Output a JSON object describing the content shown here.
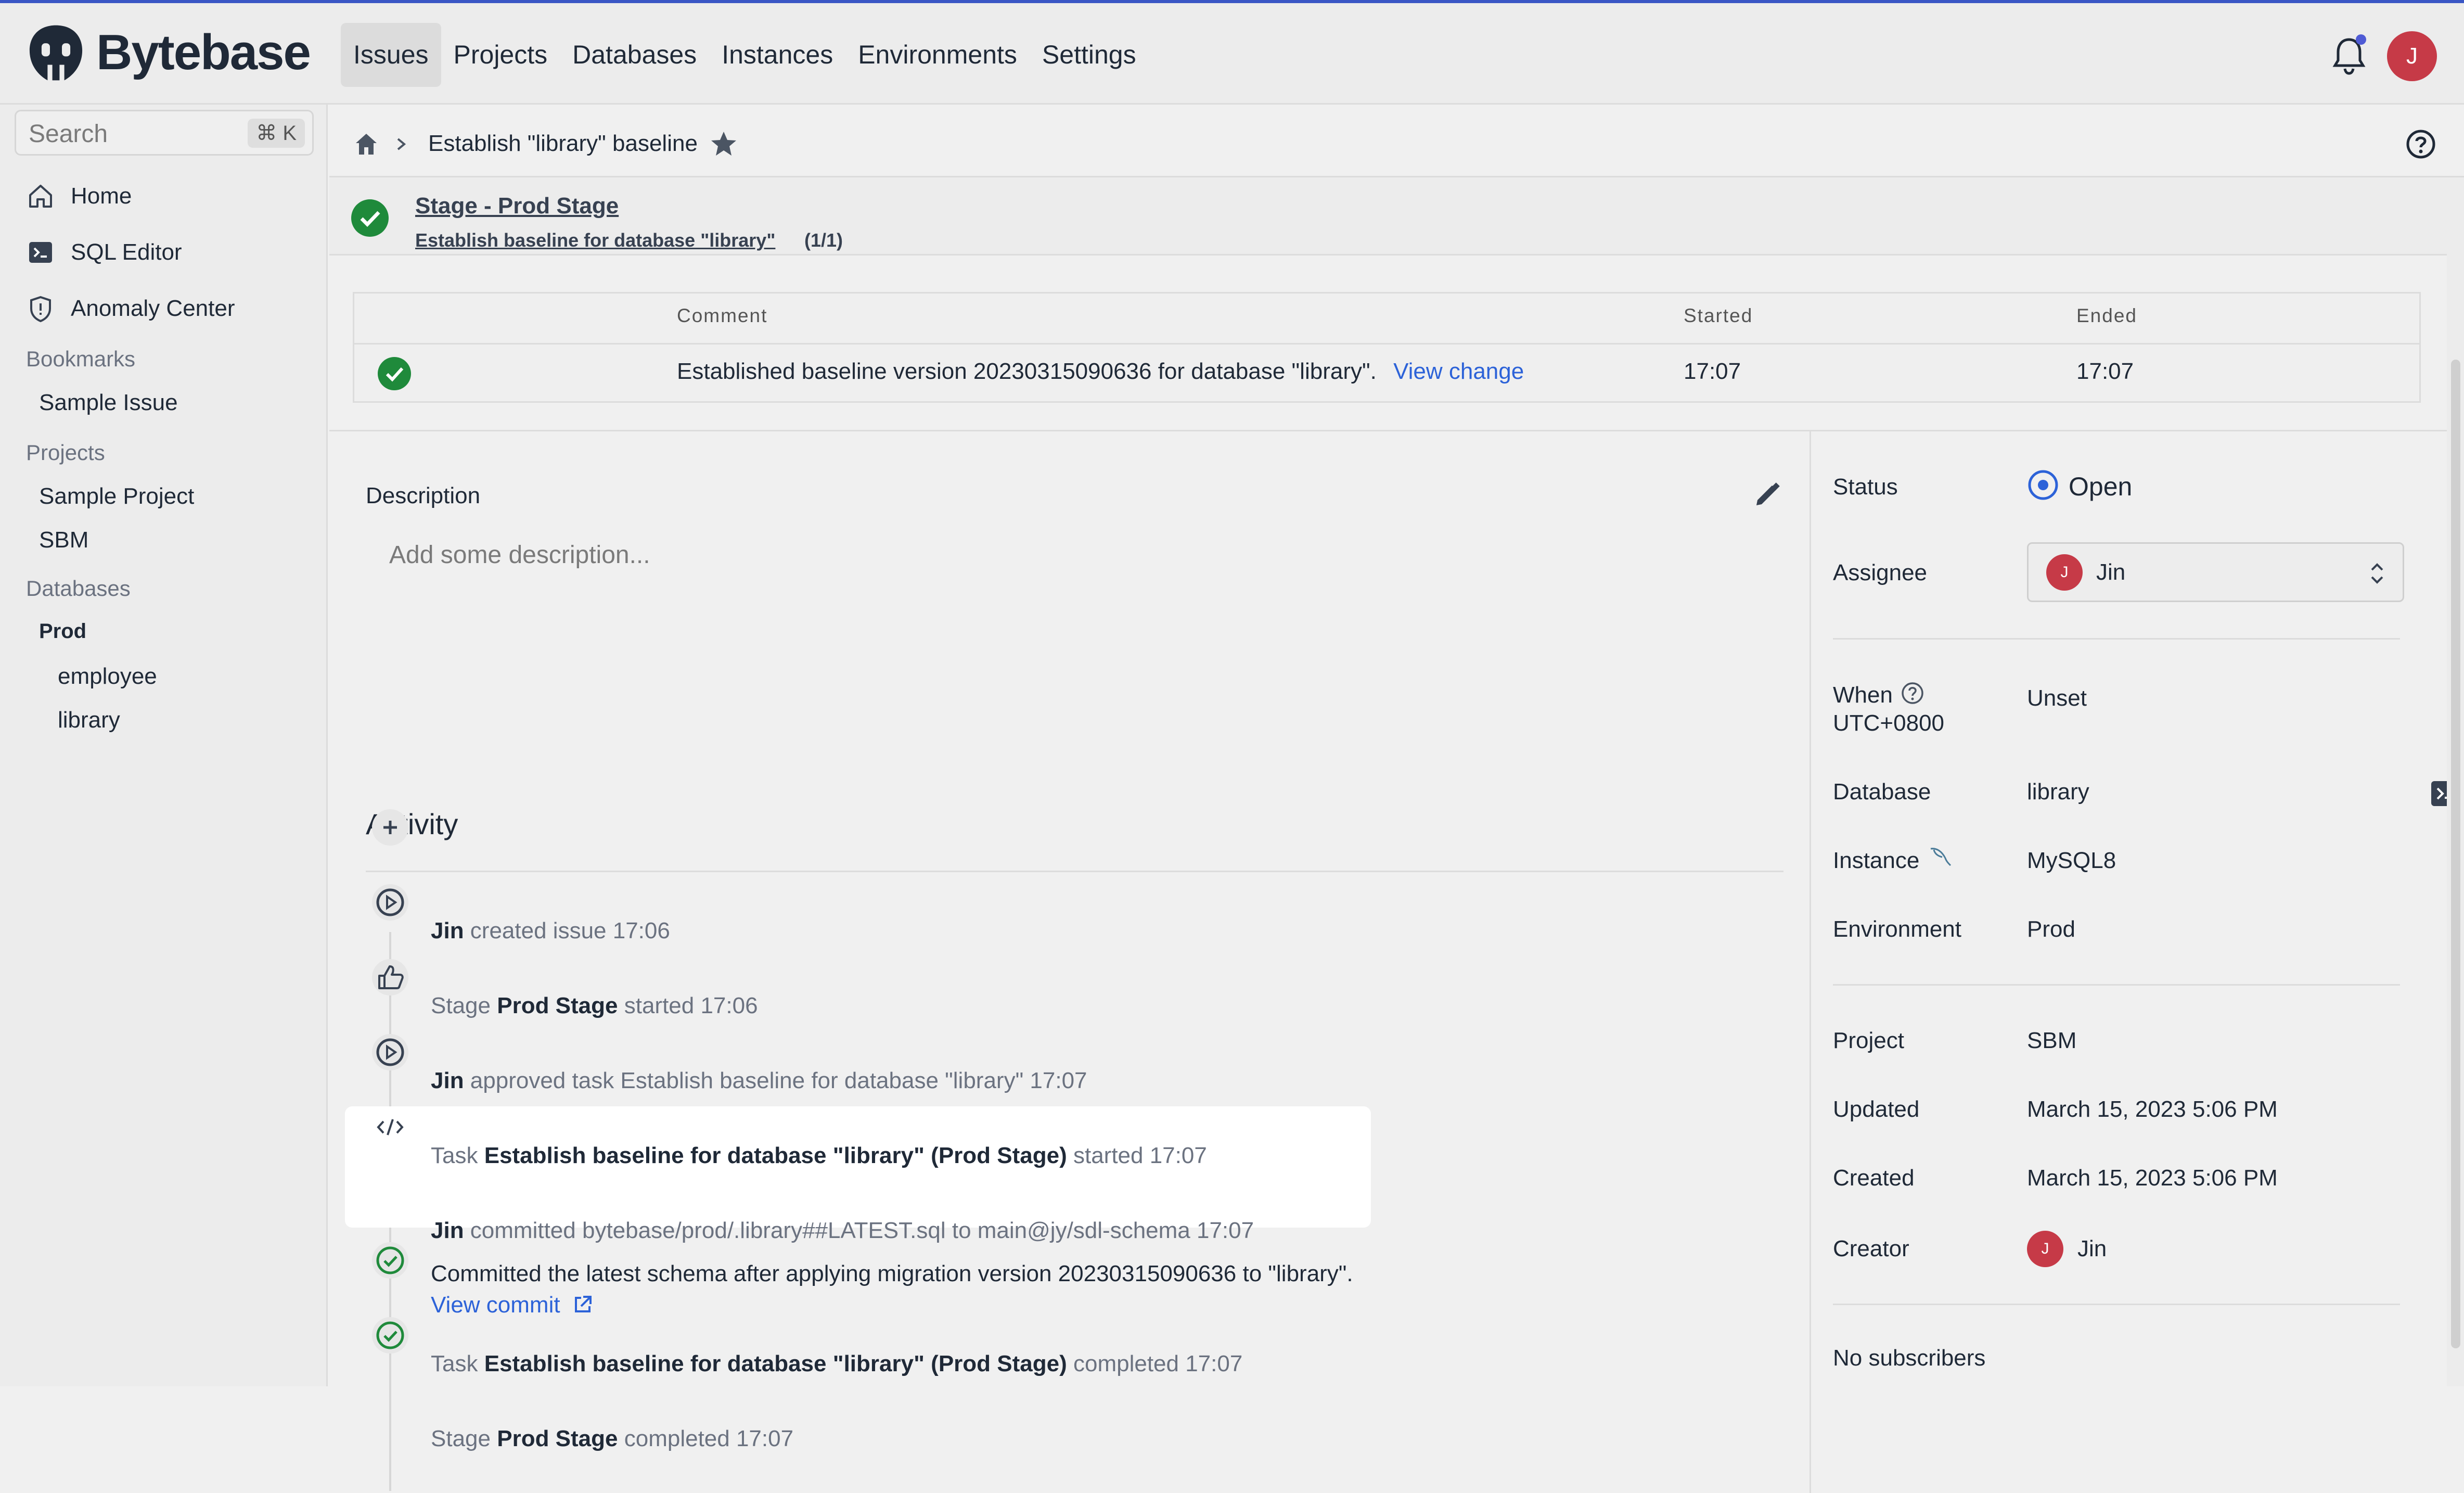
{
  "app": {
    "brand": "Bytebase"
  },
  "nav": [
    "Issues",
    "Projects",
    "Databases",
    "Instances",
    "Environments",
    "Settings"
  ],
  "user": {
    "initial": "J"
  },
  "sidebar": {
    "search_placeholder": "Search",
    "search_shortcut": "⌘ K",
    "items": [
      "Home",
      "SQL Editor",
      "Anomaly Center"
    ],
    "bookmarks_label": "Bookmarks",
    "bookmarks": [
      "Sample Issue"
    ],
    "projects_label": "Projects",
    "projects": [
      "Sample Project",
      "SBM"
    ],
    "databases_label": "Databases",
    "env": "Prod",
    "databases": [
      "employee",
      "library"
    ]
  },
  "breadcrumb": {
    "title": "Establish \"library\" baseline"
  },
  "stage": {
    "title": "Stage - Prod Stage",
    "task": "Establish baseline for database \"library\"",
    "count": "(1/1)"
  },
  "task_table": {
    "headers": [
      "Comment",
      "Started",
      "Ended"
    ],
    "row": {
      "comment": "Established baseline version 20230315090636 for database \"library\".",
      "link": "View change",
      "started": "17:07",
      "ended": "17:07"
    }
  },
  "description": {
    "label": "Description",
    "placeholder": "Add some description..."
  },
  "activity": {
    "title": "Activity",
    "items": [
      {
        "pre": "",
        "bold": "Jin",
        "post": " created issue 17:06"
      },
      {
        "pre": "Stage ",
        "bold": "Prod Stage",
        "post": " started 17:06"
      },
      {
        "pre": "",
        "bold": "Jin",
        "post": " approved task Establish baseline for database \"library\" 17:07"
      },
      {
        "pre": "Task ",
        "bold": "Establish baseline for database \"library\" (Prod Stage)",
        "post": " started 17:07"
      },
      {
        "pre": "",
        "bold": "Jin",
        "post": " committed bytebase/prod/.library##LATEST.sql to main@jy/sdl-schema 17:07"
      },
      {
        "pre": "Task ",
        "bold": "Establish baseline for database \"library\" (Prod Stage)",
        "post": " completed 17:07"
      },
      {
        "pre": "Stage ",
        "bold": "Prod Stage",
        "post": " completed 17:07"
      }
    ],
    "commit_message": "Committed the latest schema after applying migration version 20230315090636 to \"library\".",
    "commit_link": "View commit"
  },
  "details": {
    "status_label": "Status",
    "status": "Open",
    "assignee_label": "Assignee",
    "assignee": "Jin",
    "when_label": "When",
    "timezone": "UTC+0800",
    "when_value": "Unset",
    "database_label": "Database",
    "database": "library",
    "instance_label": "Instance",
    "instance": "MySQL8",
    "environment_label": "Environment",
    "environment": "Prod",
    "project_label": "Project",
    "project": "SBM",
    "updated_label": "Updated",
    "updated": "March 15, 2023 5:06 PM",
    "created_label": "Created",
    "created": "March 15, 2023 5:06 PM",
    "creator_label": "Creator",
    "creator": "Jin",
    "subscribers": "No subscribers"
  },
  "colors": {
    "accent": "#2c62d8",
    "success": "#1f8a3b",
    "avatar": "#c63a47",
    "topline": "#3a56c5"
  }
}
